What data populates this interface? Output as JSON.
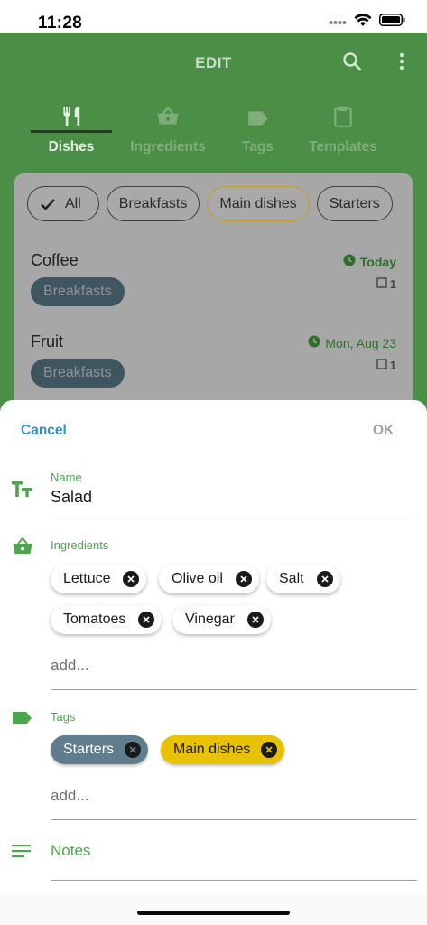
{
  "status": {
    "time": "11:28"
  },
  "appbar": {
    "title": "EDIT"
  },
  "tabs": [
    {
      "label": "Dishes",
      "icon": "fork-knife-icon",
      "active": true
    },
    {
      "label": "Ingredients",
      "icon": "basket-icon",
      "active": false
    },
    {
      "label": "Tags",
      "icon": "tag-icon",
      "active": false
    },
    {
      "label": "Templates",
      "icon": "clipboard-icon",
      "active": false
    }
  ],
  "filters": {
    "chips": [
      {
        "label": "All",
        "selected": false,
        "checked": true
      },
      {
        "label": "Breakfasts",
        "selected": false
      },
      {
        "label": "Main dishes",
        "selected": true
      },
      {
        "label": "Starters",
        "selected": false
      }
    ]
  },
  "dishes": [
    {
      "name": "Coffee",
      "tag": "Breakfasts",
      "date": "Today",
      "count": "1"
    },
    {
      "name": "Fruit",
      "tag": "Breakfasts",
      "date": "Mon, Aug 23",
      "count": "1"
    }
  ],
  "sheet": {
    "cancel_label": "Cancel",
    "ok_label": "OK",
    "name": {
      "label": "Name",
      "value": "Salad"
    },
    "ingredients": {
      "label": "Ingredients",
      "items": [
        "Lettuce",
        "Olive oil",
        "Salt",
        "Tomatoes",
        "Vinegar"
      ],
      "add_placeholder": "add..."
    },
    "tags": {
      "label": "Tags",
      "items": [
        {
          "label": "Starters",
          "bg": "#5f7d8c",
          "fg": "#ffffff"
        },
        {
          "label": "Main dishes",
          "bg": "#e8c100",
          "fg": "#1a1a1a"
        }
      ],
      "add_placeholder": "add..."
    },
    "notes": {
      "label": "Notes"
    }
  },
  "colors": {
    "primary_green": "#4a8f45",
    "accent_green": "#4ca64c",
    "link_blue": "#2f8fce"
  }
}
